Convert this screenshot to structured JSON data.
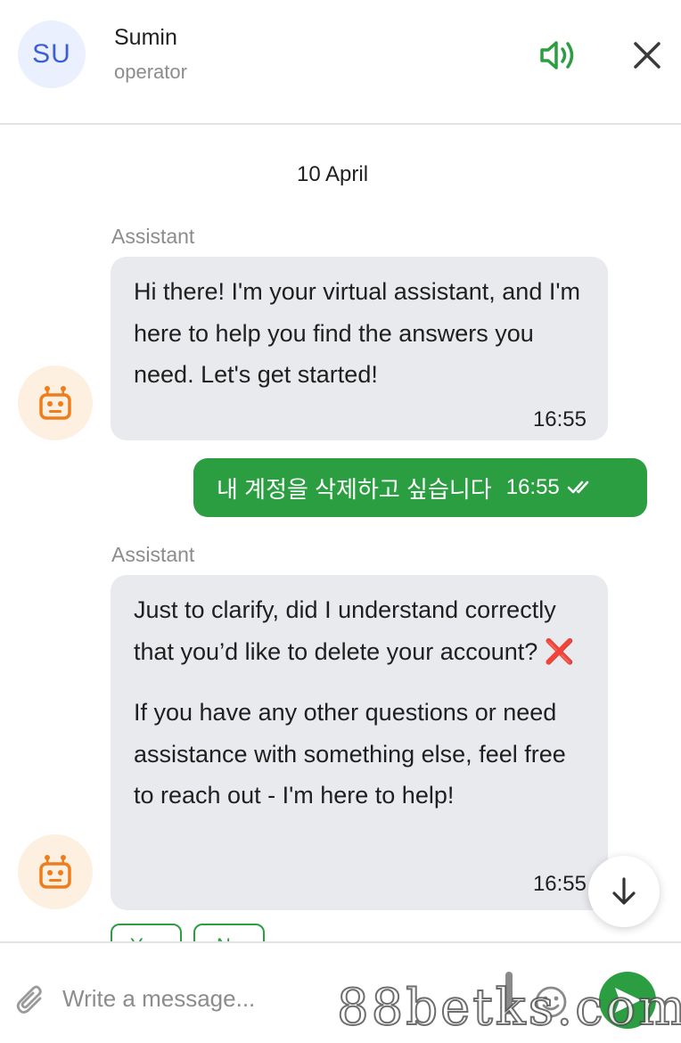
{
  "header": {
    "avatar_initials": "SU",
    "operator_name": "Sumin",
    "operator_role": "operator",
    "sound_icon": "volume-icon",
    "close_icon": "close-icon"
  },
  "chat": {
    "date_separator": "10 April",
    "messages": [
      {
        "direction": "incoming",
        "sender": "Assistant",
        "paragraphs": [
          "Hi there! I'm your virtual assistant, and I'm here to help you find the answers you need. Let's get started!"
        ],
        "time": "16:55"
      },
      {
        "direction": "outgoing",
        "text": "내 계정을 삭제하고 싶습니다",
        "time": "16:55",
        "status": "read"
      },
      {
        "direction": "incoming",
        "sender": "Assistant",
        "paragraphs": [
          "Just to clarify, did I understand correctly that you’d like to delete your account? ❌",
          "If you have any other questions or need assistance with something else, feel free to reach out - I'm here to help!"
        ],
        "time": "16:55"
      }
    ],
    "quick_replies": [
      "Yes",
      "No"
    ]
  },
  "composer": {
    "placeholder": "Write a message..."
  },
  "watermark": "88betks.com",
  "colors": {
    "accent_green": "#2b9e42",
    "bot_avatar_orange": "#ee7d1c",
    "incoming_bubble": "#e9eaed"
  }
}
